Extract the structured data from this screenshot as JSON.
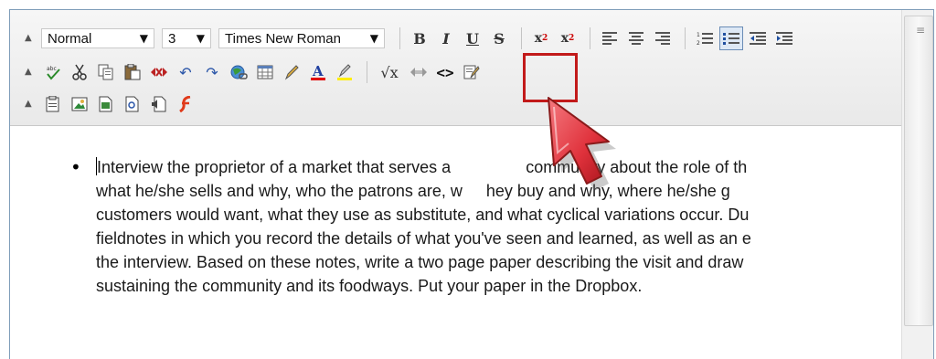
{
  "toolbar": {
    "style_select": "Normal",
    "size_select": "3",
    "font_select": "Times New Roman",
    "collapse_glyph": "▲",
    "dropdown_glyph": "▼",
    "bold": "B",
    "italic": "I",
    "underline": "U",
    "strike": "S",
    "subscript_base": "x",
    "subscript_mark": "2",
    "superscript_base": "x",
    "superscript_mark": "2",
    "source_glyph": "<>",
    "sqrt_glyph": "√x",
    "undo_glyph": "↶",
    "redo_glyph": "↷"
  },
  "editor": {
    "bullet": "•",
    "lines": [
      "Interview the proprietor of a market that serves a",
      "what he/she sells and why, who the patrons are, w",
      "customers would want, what they use as substitute, and what cyclical variations occur. Du",
      "fieldnotes in which you record the details of what you've seen and learned, as well as an e",
      "the interview. Based on these notes, write a two page paper describing the visit and draw",
      "sustaining the community and its foodways. Put your paper in the Dropbox."
    ],
    "line1_tail": "community about the role of th",
    "line2_tail": "hey buy and why, where he/she g"
  },
  "scrollbar": {
    "grip": "≡"
  },
  "colors": {
    "highlight": "#c21a1a",
    "cursor": "#e8424a",
    "font_color_bar": "#e00000",
    "highlight_color_bar": "#ffee00"
  }
}
